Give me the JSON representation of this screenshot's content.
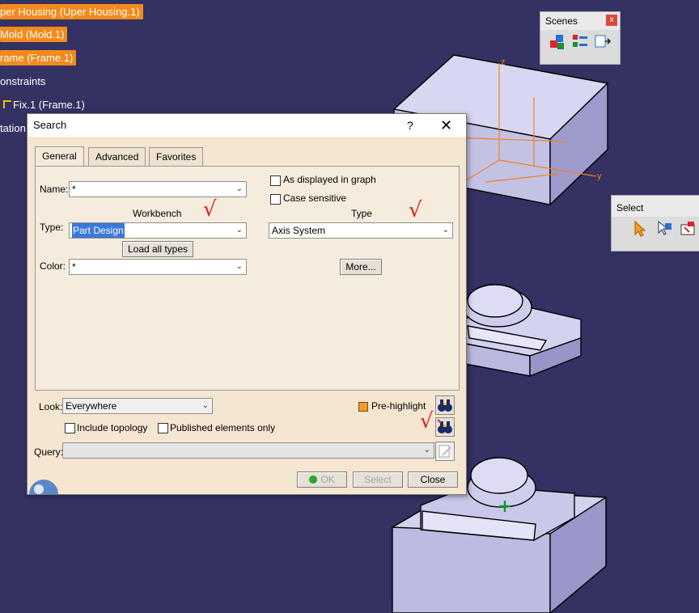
{
  "tree": {
    "items": [
      {
        "label": "per Housing (Uper Housing.1)",
        "highlighted": true
      },
      {
        "label": "Mold (Mold.1)",
        "highlighted": true
      },
      {
        "label": "rame (Frame.1)",
        "highlighted": true
      },
      {
        "label": "onstraints",
        "highlighted": false
      },
      {
        "label": "Fix.1 (Frame.1)",
        "highlighted": false
      },
      {
        "label": "tation",
        "highlighted": false
      }
    ]
  },
  "scenes_toolbar": {
    "title": "Scenes",
    "close": "x",
    "icons": [
      "scene-create-icon",
      "scene-manage-icon",
      "scene-apply-icon"
    ]
  },
  "select_toolbar": {
    "title": "Select",
    "icons": [
      "select-arrow-icon",
      "select-filter-icon",
      "select-trap-icon"
    ]
  },
  "viewport": {
    "axis_labels": {
      "x": "y",
      "z": "z"
    }
  },
  "dialog": {
    "title": "Search",
    "help": "?",
    "close": "✕",
    "tabs": [
      {
        "label": "General",
        "active": true
      },
      {
        "label": "Advanced",
        "active": false
      },
      {
        "label": "Favorites",
        "active": false
      }
    ],
    "name_label": "Name:",
    "name_value": "*",
    "workbench_header": "Workbench",
    "type_label": "Type:",
    "workbench_value": "Part Design",
    "load_all_types": "Load all types",
    "color_label": "Color:",
    "color_value": "*",
    "as_displayed_in_graph": "As displayed in graph",
    "case_sensitive": "Case sensitive",
    "type_header": "Type",
    "type_value": "Axis System",
    "more_button": "More...",
    "look_label": "Look:",
    "look_value": "Everywhere",
    "pre_highlight": "Pre-highlight",
    "include_topology": "Include topology",
    "published_only": "Published elements only",
    "query_label": "Query:",
    "query_value": "",
    "ok": "OK",
    "select": "Select",
    "close_button": "Close"
  },
  "annotations": {
    "check_mark": "√"
  },
  "colors": {
    "background": "#343163",
    "highlight": "#f38a1c",
    "dialog_body": "#f5e6d1",
    "annotation": "#e01c1c",
    "model": "#c9c8ea"
  }
}
